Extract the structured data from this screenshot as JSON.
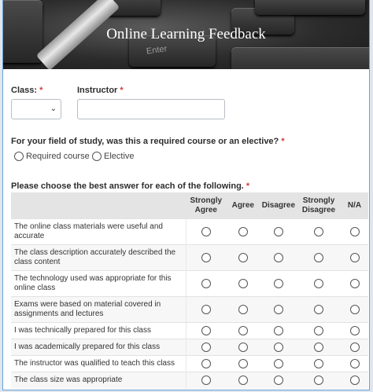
{
  "form": {
    "title": "Online Learning Feedback"
  },
  "header_graphic": {
    "key_legend": "Enter"
  },
  "class_field": {
    "label": "Class:",
    "required_mark": "*",
    "value": ""
  },
  "instructor_field": {
    "label": "Instructor",
    "required_mark": "*",
    "value": ""
  },
  "course_type": {
    "question": "For your field of study, was this a required course or an elective?",
    "required_mark": "*",
    "options": [
      "Required course",
      "Elective"
    ]
  },
  "matrix": {
    "question": "Please choose the best answer for each of the following.",
    "required_mark": "*",
    "columns": [
      "Strongly Agree",
      "Agree",
      "Disagree",
      "Strongly Disagree",
      "N/A"
    ],
    "rows": [
      "The online class materials were useful and accurate",
      "The class description accurately described the class content",
      "The technology used was appropriate for this online class",
      "Exams were based on material covered in assignments and lectures",
      "I was technically prepared for this class",
      "I was academically prepared for this class",
      "The instructor was qualified to teach this class",
      "The class size was appropriate"
    ]
  },
  "colors": {
    "required": "#d23b3b",
    "frame_border": "#6aa0d8",
    "table_header": "#e4e4e4"
  }
}
